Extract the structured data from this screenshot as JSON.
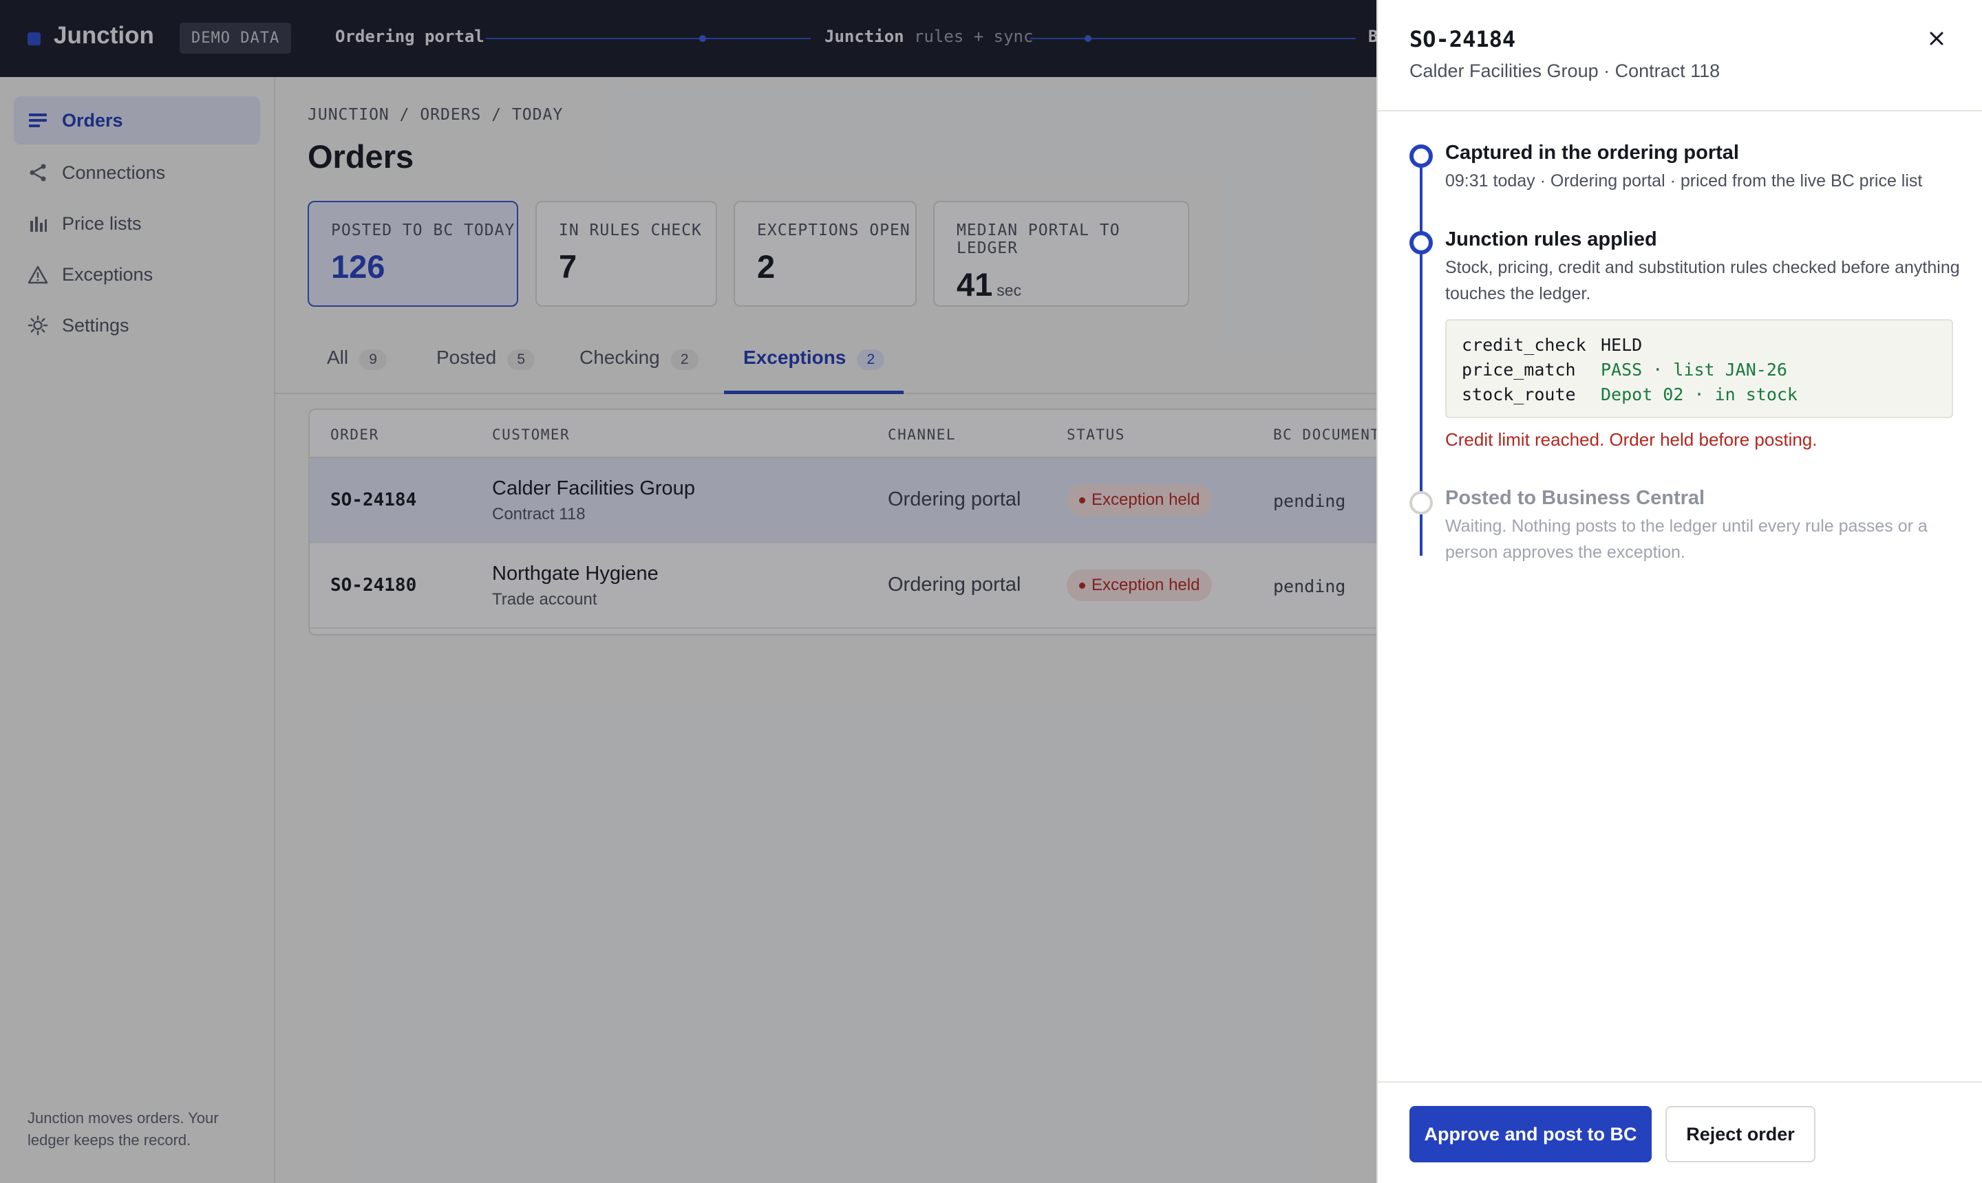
{
  "app": {
    "name": "Junction",
    "badge": "DEMO DATA"
  },
  "flow": {
    "step1": "Ordering portal",
    "step2_bold": "Junction",
    "step2_rest": " rules + sync",
    "step3": "B"
  },
  "sidebar": {
    "items": [
      {
        "label": "Orders",
        "icon": "orders-icon",
        "active": true
      },
      {
        "label": "Connections",
        "icon": "share-icon"
      },
      {
        "label": "Price lists",
        "icon": "bar-chart-icon"
      },
      {
        "label": "Exceptions",
        "icon": "warning-icon"
      },
      {
        "label": "Settings",
        "icon": "gear-icon"
      }
    ],
    "footer": "Junction moves orders. Your ledger keeps the record."
  },
  "main": {
    "breadcrumb": "JUNCTION / ORDERS / TODAY",
    "title": "Orders",
    "stats": [
      {
        "label": "POSTED TO BC TODAY",
        "value": "126",
        "unit": ""
      },
      {
        "label": "IN RULES CHECK",
        "value": "7",
        "unit": ""
      },
      {
        "label": "EXCEPTIONS OPEN",
        "value": "2",
        "unit": ""
      },
      {
        "label": "MEDIAN PORTAL TO LEDGER",
        "value": "41",
        "unit": "sec"
      }
    ],
    "tabs": [
      {
        "label": "All",
        "count": "9"
      },
      {
        "label": "Posted",
        "count": "5"
      },
      {
        "label": "Checking",
        "count": "2"
      },
      {
        "label": "Exceptions",
        "count": "2",
        "active": true
      }
    ],
    "table": {
      "headers": [
        "ORDER",
        "CUSTOMER",
        "CHANNEL",
        "STATUS",
        "BC DOCUMENT"
      ],
      "rows": [
        {
          "order": "SO-24184",
          "customer": "Calder Facilities Group",
          "customer_sub": "Contract 118",
          "channel": "Ordering portal",
          "status": "Exception held",
          "bc_document": "pending",
          "selected": true
        },
        {
          "order": "SO-24180",
          "customer": "Northgate Hygiene",
          "customer_sub": "Trade account",
          "channel": "Ordering portal",
          "status": "Exception held",
          "bc_document": "pending"
        }
      ]
    }
  },
  "drawer": {
    "title": "SO-24184",
    "subtitle": "Calder Facilities Group · Contract 118",
    "timeline": [
      {
        "title": "Captured in the ordering portal",
        "desc": "09:31 today · Ordering portal · priced from the live BC price list",
        "state": "done"
      },
      {
        "title": "Junction rules applied",
        "desc": "Stock, pricing, credit and substitution rules checked before anything touches the ledger.",
        "state": "done"
      },
      {
        "title": "Posted to Business Central",
        "desc": "Waiting. Nothing posts to the ledger until every rule passes or a person approves the exception.",
        "state": "pending"
      }
    ],
    "rules": [
      {
        "key": "credit_check",
        "value": "HELD",
        "result": "held"
      },
      {
        "key": "price_match",
        "value": "PASS · list JAN-26",
        "result": "pass"
      },
      {
        "key": "stock_route",
        "value": "Depot 02 · in stock",
        "result": "pass"
      }
    ],
    "rule_message": "Credit limit reached. Order held before posting.",
    "approve_label": "Approve and post to BC",
    "reject_label": "Reject order"
  },
  "colors": {
    "accent": "#2441be",
    "danger": "#b3261e",
    "pass": "#177a3e",
    "topbar": "#161a25"
  }
}
